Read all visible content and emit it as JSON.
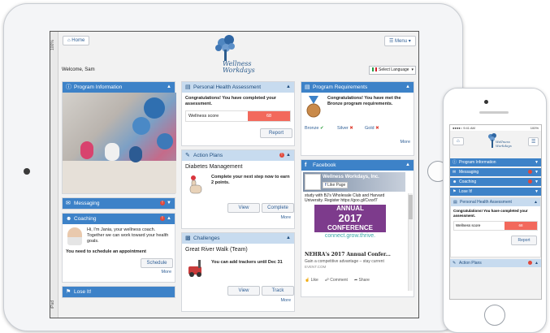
{
  "tablet": {
    "status_battery": "100%",
    "status_carrier": "iPad",
    "header": {
      "home_label": "Home",
      "menu_label": "Menu",
      "logo_line1": "Wellness",
      "logo_line2": "Workdays",
      "welcome": "Welcome, Sam",
      "language_label": "Select Language"
    },
    "program_info": {
      "title": "Program Information"
    },
    "messaging": {
      "title": "Messaging"
    },
    "coaching": {
      "title": "Coaching",
      "text": "Hi, I'm Jania, your wellness coach. Together we can work toward your health goals.",
      "cta": "You need to schedule an appointment",
      "button": "Schedule",
      "more": "More"
    },
    "lose_it": {
      "title": "Lose It!"
    },
    "pha": {
      "title": "Personal Health Assessment",
      "message": "Congratulations! You have completed your assessment.",
      "score_label": "Wellness score",
      "score_value": "68",
      "button": "Report"
    },
    "action_plans": {
      "title": "Action Plans",
      "item_title": "Diabetes Management",
      "item_text": "Complete your next step now to earn 2 points.",
      "view": "View",
      "complete": "Complete",
      "more": "More"
    },
    "challenges": {
      "title": "Challenges",
      "item_title": "Great River Walk (Team)",
      "item_text": "You can add trackers until Dec 31",
      "view": "View",
      "track": "Track",
      "more": "More"
    },
    "requirements": {
      "title": "Program Requirements",
      "message": "Congratulations! You have met the Bronze program requirements.",
      "bronze": "Bronze",
      "silver": "Silver",
      "gold": "Gold",
      "more": "More"
    },
    "facebook": {
      "title": "Facebook",
      "page_name": "Wellness Workdays, Inc.",
      "like_page": "Like Page",
      "post_text": "study with BJ's Wholesale Club and Harvard University. Register https://goo.gl/Cvsxf7",
      "conf_line1": "ANNUAL",
      "conf_line2": "2017",
      "conf_line3": "CONFERENCE",
      "conf_line4": "connect.grow.thrive.",
      "link_title": "NEHRA's 2017 Annual Confer...",
      "link_desc": "Gain a competitive advantage – stay current",
      "link_domain": "EVENT.COM",
      "like": "Like",
      "comment": "Comment",
      "share": "Share"
    }
  },
  "phone": {
    "status_time": "9:41 AM",
    "status_battery": "100%",
    "logo_line1": "Wellness",
    "logo_line2": "Workdays",
    "items": [
      {
        "label": "Program Information"
      },
      {
        "label": "Messaging"
      },
      {
        "label": "Coaching"
      },
      {
        "label": "Lose It!"
      }
    ],
    "pha": {
      "title": "Personal Health Assessment",
      "message": "Congratulations! You have completed your assessment.",
      "score_label": "Wellness score",
      "score_value": "68",
      "button": "Report"
    },
    "action_plans": "Action Plans"
  },
  "colors": {
    "primary_header": "#3d82c8",
    "light_header": "#c7dbef",
    "score": "#f2695c",
    "alert": "#e0483b",
    "link": "#2f5f96"
  }
}
